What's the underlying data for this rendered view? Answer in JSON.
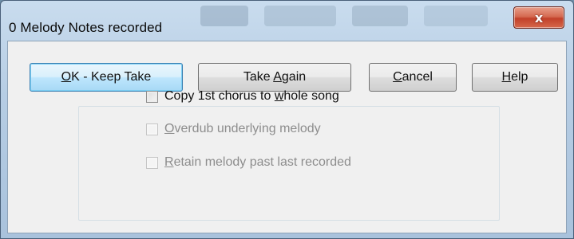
{
  "window": {
    "title": "0 Melody Notes recorded",
    "close_glyph": "x"
  },
  "buttons": {
    "ok": {
      "pre": "",
      "accel": "O",
      "post": "K - Keep Take",
      "is_default": true
    },
    "take_again": {
      "pre": "Take ",
      "accel": "A",
      "post": "gain"
    },
    "cancel": {
      "pre": "",
      "accel": "C",
      "post": "ancel"
    },
    "help": {
      "pre": "",
      "accel": "H",
      "post": "elp"
    }
  },
  "options": [
    {
      "pre": "Copy 1st chorus to ",
      "accel": "w",
      "post": "hole song",
      "checked": false,
      "enabled": true
    },
    {
      "pre": "",
      "accel": "O",
      "post": "verdub underlying melody",
      "checked": false,
      "enabled": false
    },
    {
      "pre": "",
      "accel": "R",
      "post": "etain melody past last recorded",
      "checked": false,
      "enabled": false
    }
  ],
  "colors": {
    "title_glass": "#b6cde4",
    "close_red": "#c2412a",
    "dialog_face": "#f0f0f0",
    "default_button_blue": "#a7d9f5",
    "disabled_text": "#8d8d8d"
  }
}
